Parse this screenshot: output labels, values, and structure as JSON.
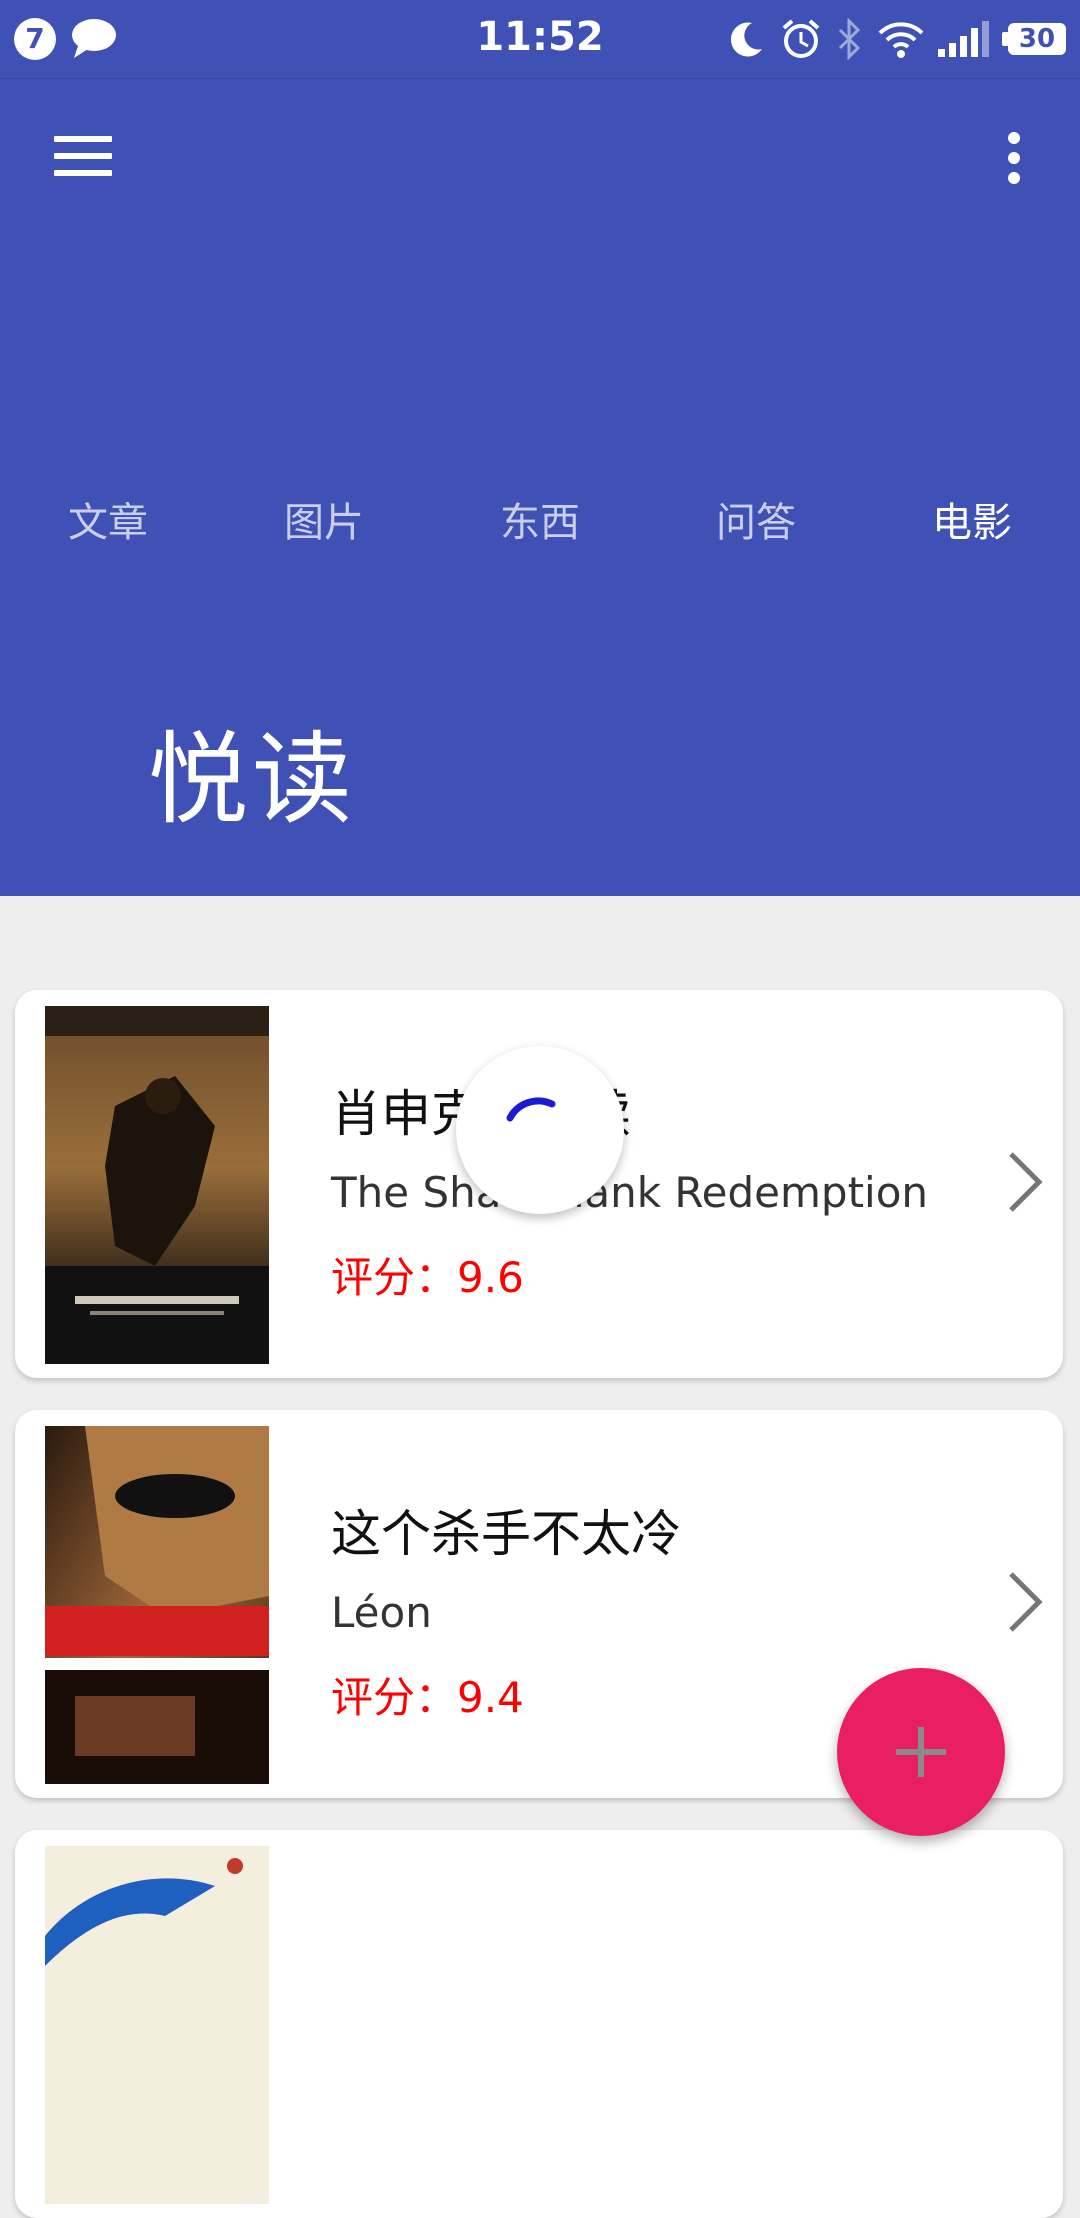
{
  "status_bar": {
    "notification_count": "7",
    "time": "11:52",
    "battery": "30"
  },
  "toolbar": {
    "menu_icon": "hamburger-menu-icon",
    "overflow_icon": "more-vert-icon"
  },
  "tabs": [
    {
      "label": "文章"
    },
    {
      "label": "图片"
    },
    {
      "label": "东西"
    },
    {
      "label": "问答"
    },
    {
      "label": "电影",
      "active": true
    }
  ],
  "header_title": "悦读",
  "movies": [
    {
      "title": "肖申克的救赎",
      "subtitle": "The Shawshank Redemption",
      "rating_label": "评分：",
      "rating": "9.6"
    },
    {
      "title": "这个杀手不太冷",
      "subtitle": "Léon",
      "rating_label": "评分：",
      "rating": "9.4"
    }
  ],
  "fab": {
    "icon": "plus-icon"
  },
  "colors": {
    "primary": "#3f51b5",
    "accent": "#e91e63",
    "rating": "#ff0000",
    "background": "#eeeeee"
  }
}
